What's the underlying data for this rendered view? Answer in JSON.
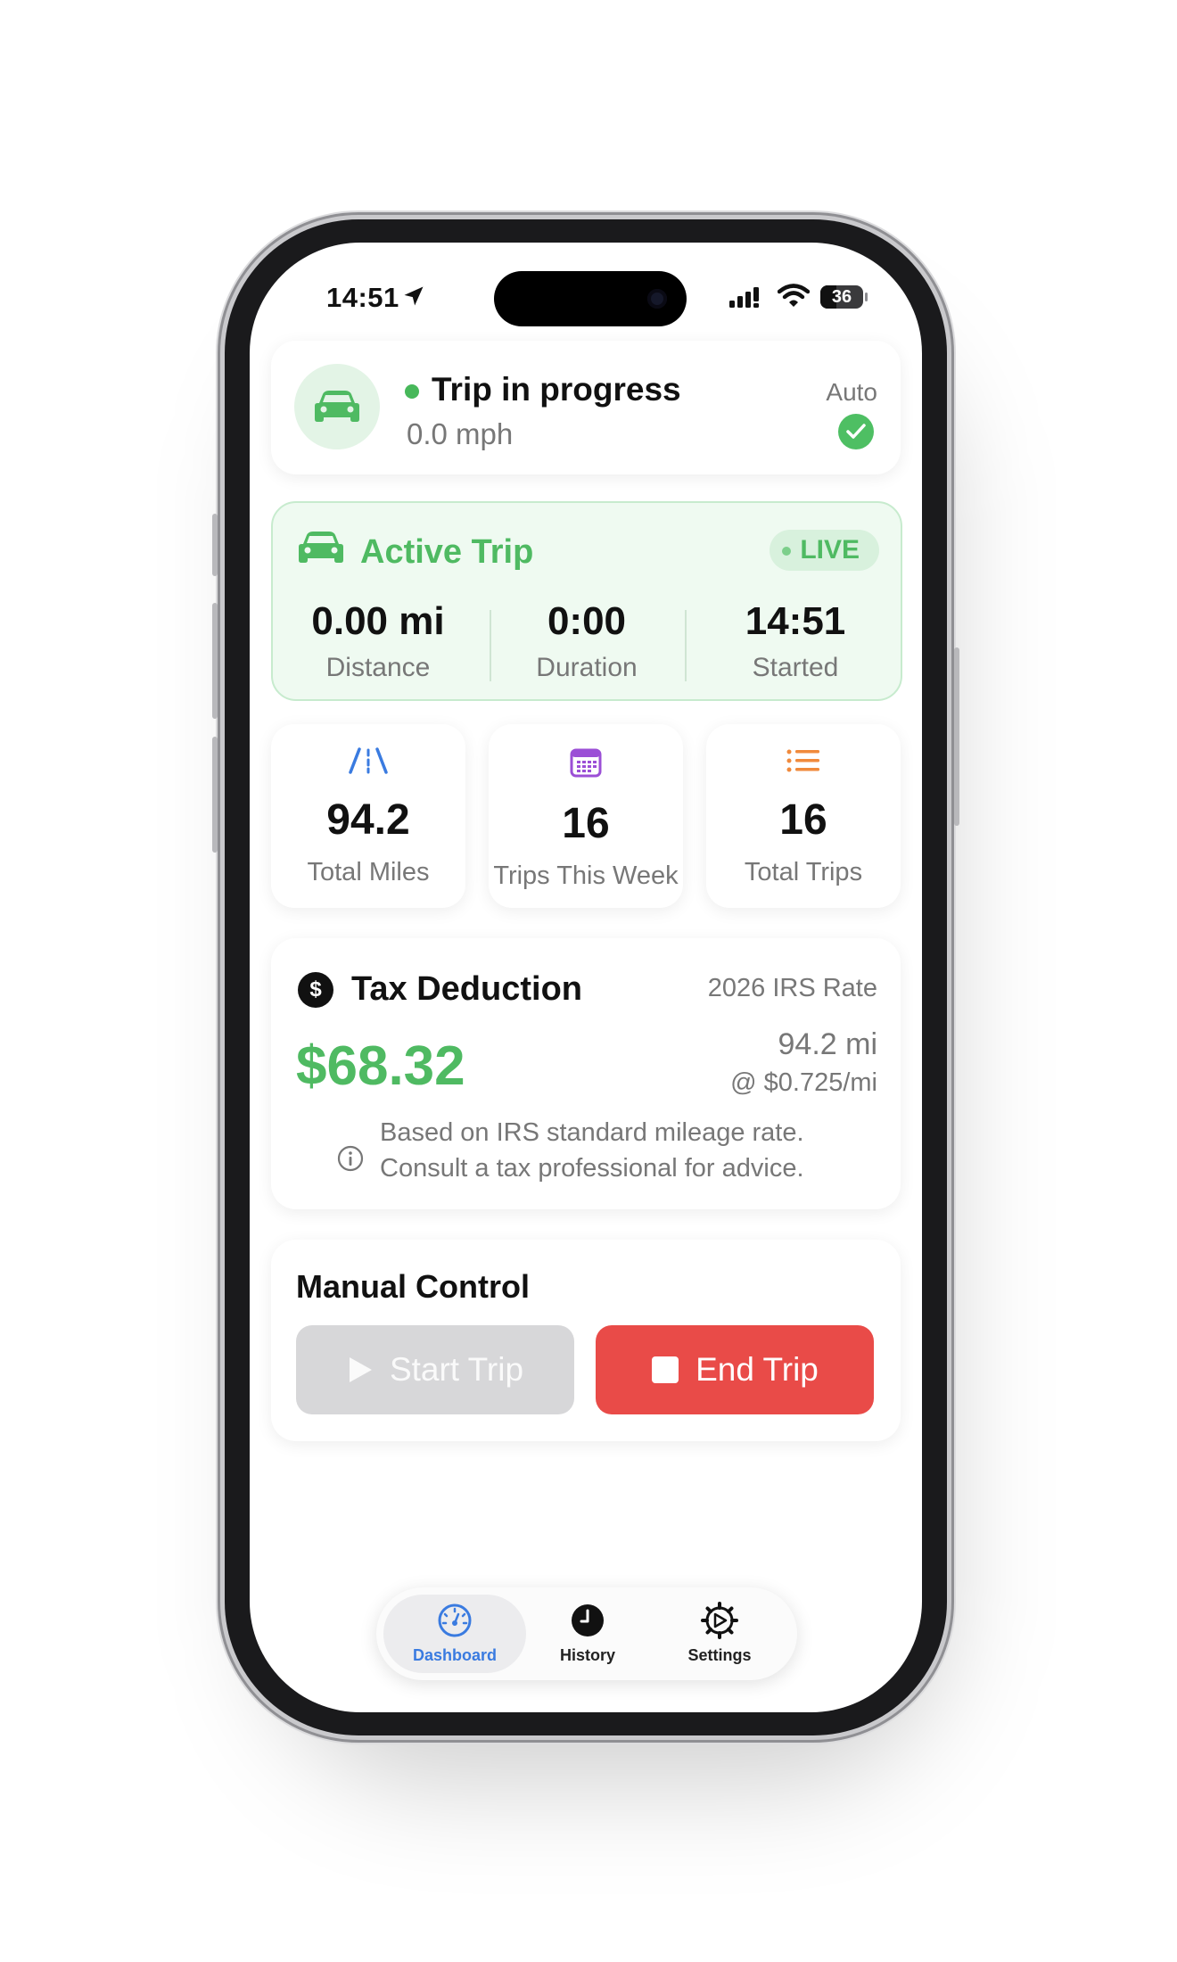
{
  "status_bar": {
    "time": "14:51",
    "battery": "36"
  },
  "trip_status": {
    "title": "Trip in progress",
    "speed": "0.0 mph",
    "auto_label": "Auto"
  },
  "active_trip": {
    "title": "Active Trip",
    "badge": "LIVE",
    "stats": [
      {
        "value": "0.00 mi",
        "label": "Distance"
      },
      {
        "value": "0:00",
        "label": "Duration"
      },
      {
        "value": "14:51",
        "label": "Started"
      }
    ]
  },
  "summary": [
    {
      "value": "94.2",
      "label": "Total Miles",
      "icon": "road-icon"
    },
    {
      "value": "16",
      "label": "Trips This Week",
      "icon": "calendar-icon"
    },
    {
      "value": "16",
      "label": "Total Trips",
      "icon": "list-icon"
    }
  ],
  "tax": {
    "title": "Tax Deduction",
    "rate_label": "2026 IRS Rate",
    "amount": "$68.32",
    "miles": "94.2 mi",
    "per_mile": "@ $0.725/mi",
    "note_line1": "Based on IRS standard mileage rate.",
    "note_line2": "Consult a tax professional for advice."
  },
  "manual": {
    "title": "Manual Control",
    "start_label": "Start Trip",
    "end_label": "End Trip"
  },
  "tabs": [
    {
      "label": "Dashboard",
      "icon": "gauge-icon",
      "active": true
    },
    {
      "label": "History",
      "icon": "clock-icon",
      "active": false
    },
    {
      "label": "Settings",
      "icon": "gear-icon",
      "active": false
    }
  ],
  "colors": {
    "accent_green": "#4fba62",
    "danger_red": "#e94b48",
    "tab_active_blue": "#3a7be0"
  }
}
